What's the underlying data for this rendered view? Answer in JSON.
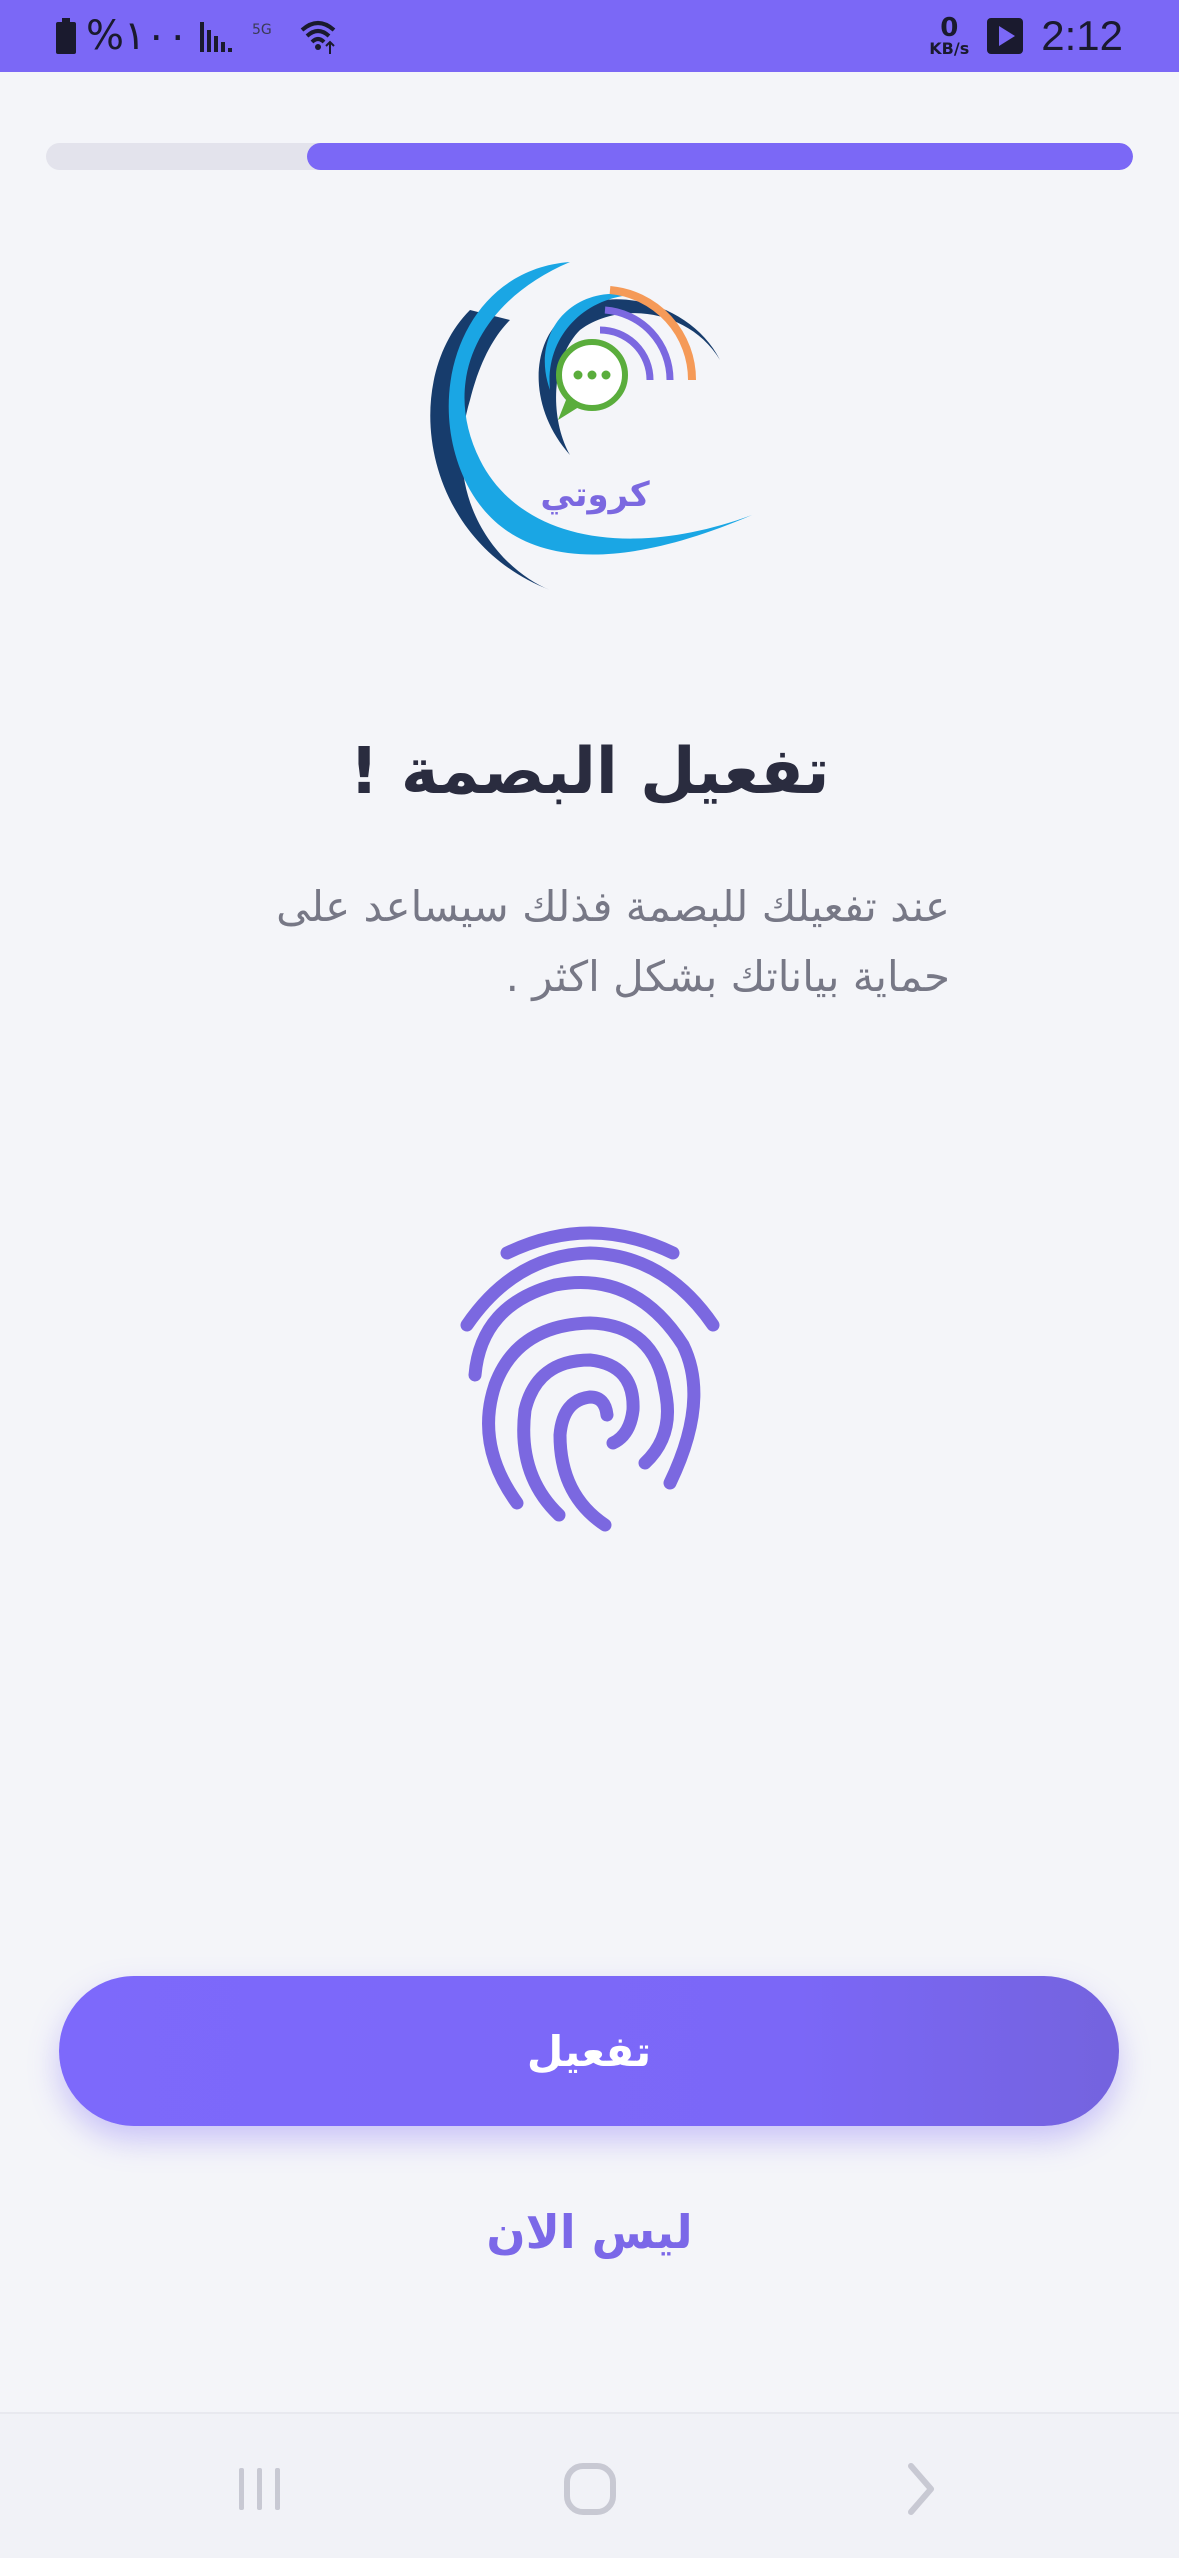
{
  "status_bar": {
    "battery_text": "%١٠٠",
    "net_speed_value": "0",
    "net_speed_unit": "KB/s",
    "time": "2:12"
  },
  "progress": {
    "fraction": 0.76
  },
  "logo": {
    "brand_text": "كروتي"
  },
  "content": {
    "title": "تفعيل البصمة !",
    "description_lines": [
      "عند تفعيلك للبصمة فذلك سيساعد على",
      "حماية بياناتك  بشكل اكثر ."
    ]
  },
  "actions": {
    "activate_label": "تفعيل",
    "not_now_label": "ليس الان"
  },
  "icons": {
    "battery": "battery-icon",
    "signal": "signal-icon",
    "wifi": "wifi-icon",
    "media": "play-icon",
    "fingerprint": "fingerprint-icon",
    "nav_recents": "recents-icon",
    "nav_home": "home-icon",
    "nav_back": "back-icon"
  },
  "colors": {
    "accent": "#7b68f6",
    "title": "#2a2c3f",
    "description": "#777886",
    "fingerprint": "#7b68e0"
  }
}
